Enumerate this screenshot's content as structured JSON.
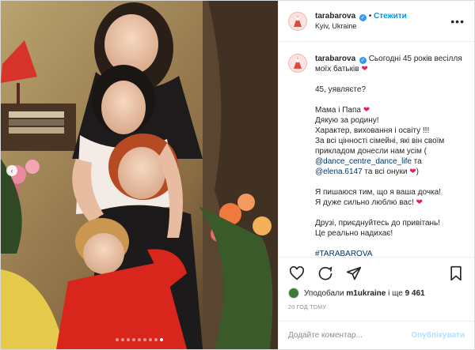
{
  "header": {
    "username": "tarabarova",
    "follow": "Стежити",
    "location": "Kyiv, Ukraine",
    "more": "•••"
  },
  "caption": {
    "username": "tarabarova",
    "line1": "Сьогодні 45 років весілля моїх батьків",
    "p2": "45, уявляєте?",
    "p3_l1": "Мама і Папа",
    "p3_l2": "Дякую за родину!",
    "p3_l3": "Характер, виховання і освіту !!!",
    "p3_l4": "За всі цінності сімейні, які він своїм прикладом донесли нам усім (",
    "mention1": "@dance_centre_dance_life",
    "p3_and": " та ",
    "mention2": "@elena.6147",
    "p3_tail": " та всі онуки",
    "p4_l1": "Я пишаюся тим, що я ваша дочка!",
    "p4_l2": "Я дуже сильно люблю вас!",
    "p5_l1": "Друзі, приєднуйтесь до привітань!",
    "p5_l2": "Це реально надихає!",
    "hashtag": "#TARABAROVA"
  },
  "likes": {
    "prefix": "Уподобали ",
    "user": "m1ukraine",
    "middle": " і ще ",
    "count": "9 461"
  },
  "time": "20 ГОД ТОМУ",
  "comment": {
    "placeholder": "Додайте коментар...",
    "publish": "Опублікувати"
  },
  "icons": {
    "like": "heart-outline-icon",
    "comment": "comment-icon",
    "share": "send-icon",
    "save": "bookmark-icon",
    "nav_prev": "chevron-left-icon"
  },
  "carousel": {
    "slides": 9,
    "active": 8
  },
  "colors": {
    "link": "#0095f6",
    "mention": "#00376b",
    "heart": "#e0245e",
    "verified": "#3897f0"
  }
}
